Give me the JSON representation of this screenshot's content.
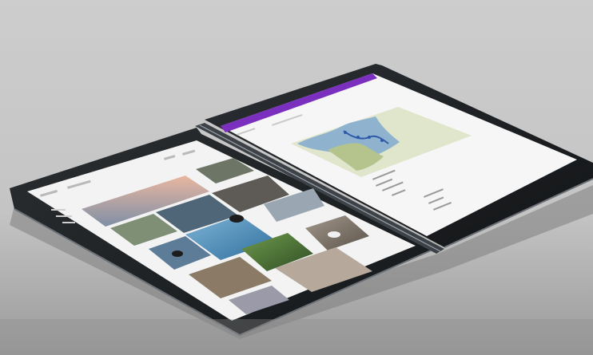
{
  "scene": {
    "description_tag": "photo",
    "background_color": "#c8c8c8",
    "device_body_color": "#1f2326",
    "device_edge_color": "#5a6066",
    "screen_color": "#f4f4f4",
    "accent_bar_color": "#7b2fbf"
  },
  "left_screen": {
    "app": "photo-gallery",
    "photo_tile_count": 12
  },
  "right_screen": {
    "app": "map-notes",
    "header_color": "#7b2fbf",
    "map_land_color": "#c9d3a5",
    "map_water_color": "#8fb2cf"
  }
}
